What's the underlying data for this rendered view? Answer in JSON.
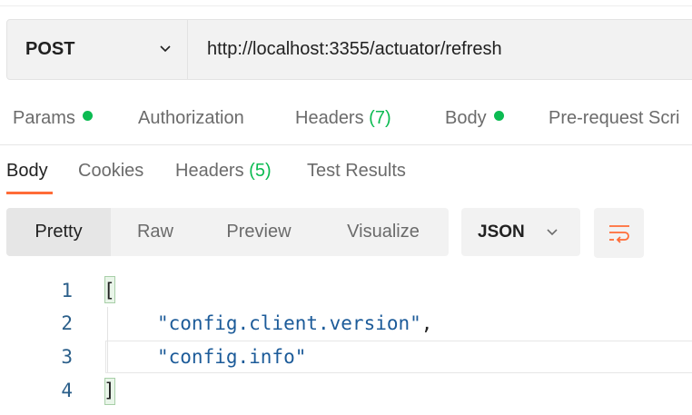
{
  "request": {
    "method": "POST",
    "url": "http://localhost:3355/actuator/refresh"
  },
  "request_tabs": {
    "params": "Params",
    "authorization": "Authorization",
    "headers": "Headers",
    "headers_count": "(7)",
    "body": "Body",
    "prerequest": "Pre-request Scri"
  },
  "response_tabs": {
    "body": "Body",
    "cookies": "Cookies",
    "headers": "Headers",
    "headers_count": "(5)",
    "test_results": "Test Results"
  },
  "view_modes": {
    "pretty": "Pretty",
    "raw": "Raw",
    "preview": "Preview",
    "visualize": "Visualize",
    "selected": "Pretty"
  },
  "format": "JSON",
  "code": {
    "line_numbers": [
      "1",
      "2",
      "3",
      "4"
    ],
    "lines": [
      "[",
      "\"config.client.version\"",
      "\"config.info\"",
      "]"
    ],
    "comma": ","
  },
  "colors": {
    "accent": "#ff6c37",
    "status_green": "#0cbb52",
    "string": "#1c5b99"
  },
  "icons": {
    "method_dropdown": "chevron-down-icon",
    "format_dropdown": "chevron-down-icon",
    "wrap": "wrap-lines-icon"
  }
}
